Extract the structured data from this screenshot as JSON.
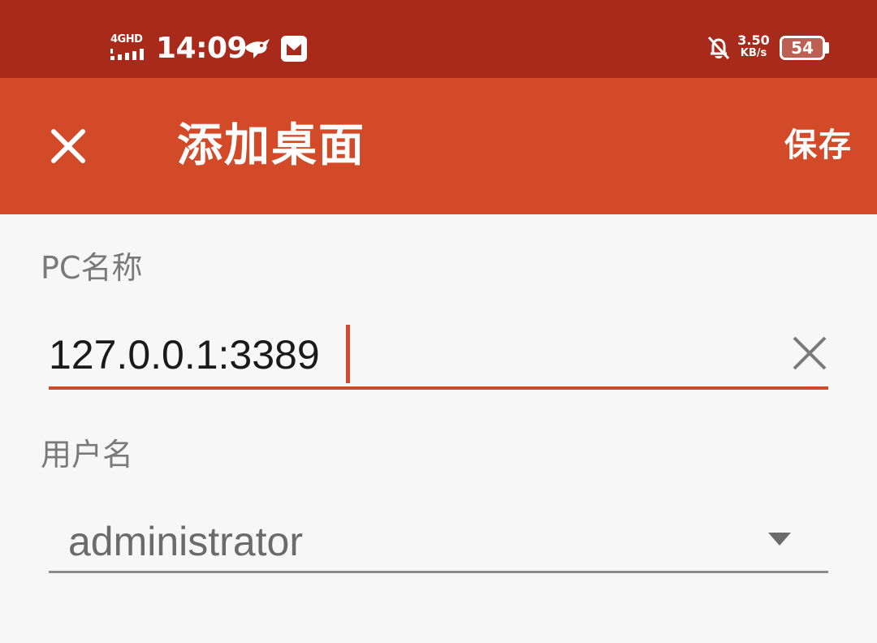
{
  "status_bar": {
    "network_label": "4GHD",
    "time": "14:09",
    "speed_value": "3.50",
    "speed_unit": "KB/s",
    "battery_level": "54",
    "icons": [
      "signal-icon",
      "bird-icon",
      "app-notification-icon",
      "bell-off-icon",
      "battery-icon"
    ]
  },
  "toolbar": {
    "close_icon": "close-icon",
    "title": "添加桌面",
    "save_label": "保存",
    "background": "#d24a28"
  },
  "form": {
    "pc_name": {
      "label": "PC名称",
      "value": "127.0.0.1:3389",
      "clear_icon": "clear-icon"
    },
    "username": {
      "label": "用户名",
      "value": "administrator",
      "dropdown_icon": "dropdown-arrow-icon"
    }
  },
  "colors": {
    "status_bar": "#a82a1b",
    "accent": "#d24a28",
    "page_bg": "#f7f7f7"
  }
}
